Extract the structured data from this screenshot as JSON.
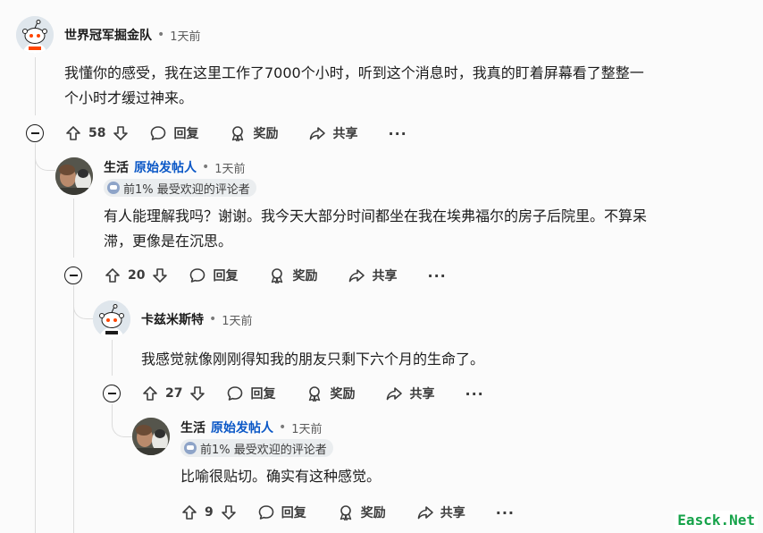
{
  "comments": [
    {
      "username": "世界冠军掘金队",
      "separator": "•",
      "time": "1天前",
      "text_lines": [
        "我懂你的感受，我在这里工作了7000个小时，听到这个消息时，我真的盯着屏幕看了整整一",
        "个小时才缓过神来。"
      ],
      "votes": "58"
    },
    {
      "username": "生活",
      "op_tag": "原始发帖人",
      "separator": "•",
      "time": "1天前",
      "badge": "前1% 最受欢迎的评论者",
      "text_lines": [
        "有人能理解我吗？谢谢。我今天大部分时间都坐在我在埃弗福尔的房子后院里。不算呆",
        "滞，更像是在沉思。"
      ],
      "votes": "20"
    },
    {
      "username": "卡兹米斯特",
      "separator": "•",
      "time": "1天前",
      "text_lines": [
        "我感觉就像刚刚得知我的朋友只剩下六个月的生命了。"
      ],
      "votes": "27"
    },
    {
      "username": "生活",
      "op_tag": "原始发帖人",
      "separator": "•",
      "time": "1天前",
      "badge": "前1% 最受欢迎的评论者",
      "text_lines": [
        "比喻很贴切。确实有这种感觉。"
      ],
      "votes": "9"
    }
  ],
  "actions": {
    "reply": "回复",
    "award": "奖励",
    "share": "共享",
    "more": "···"
  },
  "icons": [
    "collapse-icon",
    "upvote-icon",
    "downvote-icon",
    "reply-icon",
    "award-icon",
    "share-icon",
    "more-icon",
    "reddit-snoo-avatar",
    "user-photo-avatar",
    "badge-icon"
  ],
  "watermark": "Easck.Net",
  "colors": {
    "background": "#fbfbfb",
    "op_blue": "#0a57c6",
    "watermark_green": "#16a34a"
  }
}
